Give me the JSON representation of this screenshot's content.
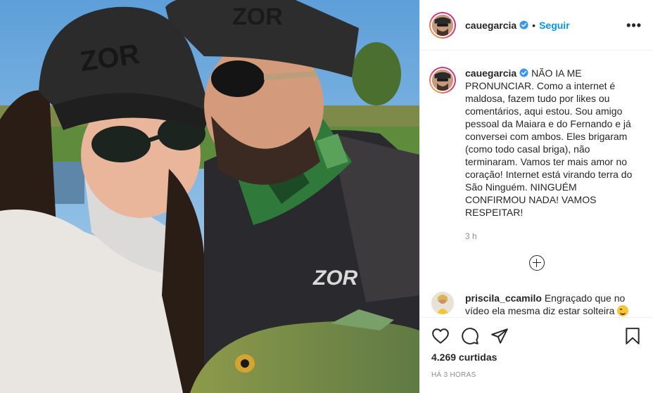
{
  "post": {
    "photo_alt": "",
    "header": {
      "username": "cauegarcia",
      "separator": "•",
      "follow_label": "Seguir",
      "more_label": "•••"
    },
    "caption": {
      "username": "cauegarcia",
      "text": "NÃO IA ME PRONUNCIAR. Como a internet é maldosa, fazem tudo por likes ou comentários, aqui estou. Sou amigo pessoal da Maiara e do Fernando e já conversei com ambos. Eles brigaram (como todo casal briga), não terminaram. Vamos ter mais amor no coração! Internet está virando terra do São Ninguém. NINGUÉM CONFIRMOU NADA! VAMOS RESPEITAR!",
      "time": "3 h"
    },
    "comments": [
      {
        "username": "priscila_ccamilo",
        "text": "Engraçado que no vídeo ela mesma diz estar solteira"
      }
    ],
    "likes": "4.269 curtidas",
    "posted_ago": "HÁ 3 HORAS"
  },
  "colors": {
    "link_blue": "#0095f6",
    "verified_blue": "#3897f0",
    "text": "#262626",
    "muted": "#8e8e8e",
    "border": "#efefef"
  },
  "icons": [
    "verified-icon",
    "heart-icon",
    "comment-icon",
    "share-icon",
    "bookmark-icon",
    "plus-circle-icon",
    "more-icon"
  ]
}
